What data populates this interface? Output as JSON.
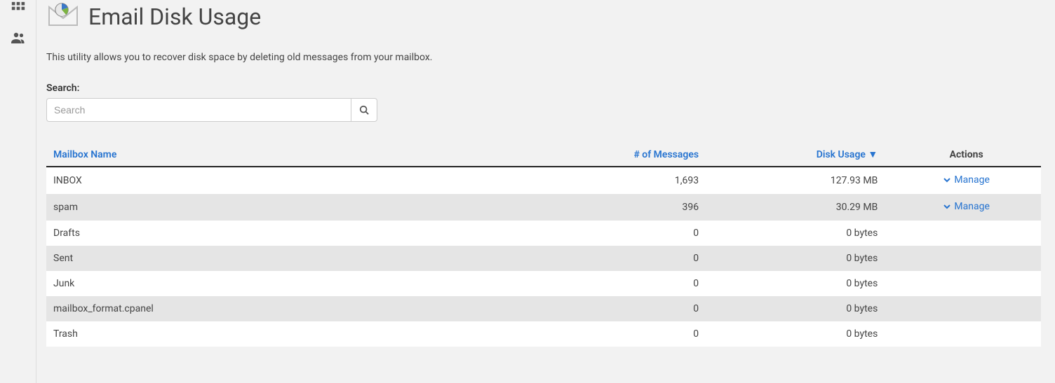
{
  "page": {
    "title": "Email Disk Usage",
    "description": "This utility allows you to recover disk space by deleting old messages from your mailbox."
  },
  "search": {
    "label": "Search:",
    "placeholder": "Search",
    "value": ""
  },
  "table": {
    "headers": {
      "name": "Mailbox Name",
      "messages": "# of Messages",
      "disk": "Disk Usage ▼",
      "actions": "Actions"
    },
    "manage_label": "Manage",
    "rows": [
      {
        "name": "INBOX",
        "messages": "1,693",
        "disk": "127.93 MB",
        "manage": true
      },
      {
        "name": "spam",
        "messages": "396",
        "disk": "30.29 MB",
        "manage": true
      },
      {
        "name": "Drafts",
        "messages": "0",
        "disk": "0 bytes",
        "manage": false
      },
      {
        "name": "Sent",
        "messages": "0",
        "disk": "0 bytes",
        "manage": false
      },
      {
        "name": "Junk",
        "messages": "0",
        "disk": "0 bytes",
        "manage": false
      },
      {
        "name": "mailbox_format.cpanel",
        "messages": "0",
        "disk": "0 bytes",
        "manage": false
      },
      {
        "name": "Trash",
        "messages": "0",
        "disk": "0 bytes",
        "manage": false
      }
    ]
  }
}
